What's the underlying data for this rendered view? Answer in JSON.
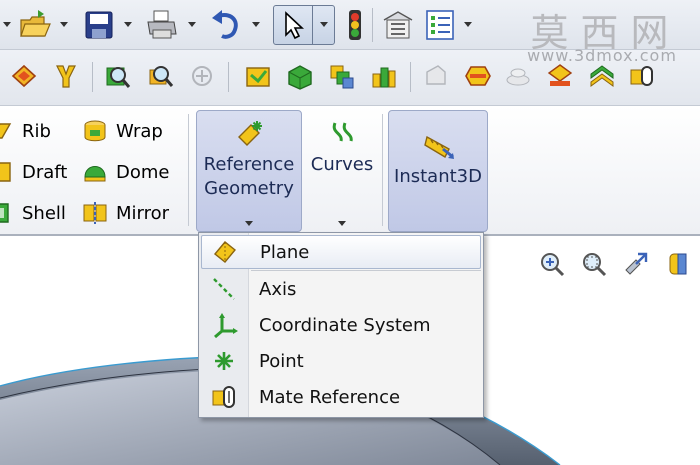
{
  "watermark": {
    "chinese": "莫西网",
    "url": "www.3dmox.com"
  },
  "toolbar_top": {
    "buttons": [
      {
        "id": "open",
        "icon": "open-folder-icon"
      },
      {
        "id": "save",
        "icon": "save-icon"
      },
      {
        "id": "print",
        "icon": "print-icon"
      },
      {
        "id": "undo",
        "icon": "undo-icon"
      },
      {
        "id": "select",
        "icon": "select-arrow-icon"
      },
      {
        "id": "rebuild",
        "icon": "traffic-light-icon"
      },
      {
        "id": "file-properties",
        "icon": "file-properties-icon"
      },
      {
        "id": "options",
        "icon": "options-list-icon"
      }
    ]
  },
  "features": {
    "col1": [
      {
        "label": "Rib",
        "icon": "rib-icon"
      },
      {
        "label": "Draft",
        "icon": "draft-icon"
      },
      {
        "label": "Shell",
        "icon": "shell-icon"
      }
    ],
    "col2": [
      {
        "label": "Wrap",
        "icon": "wrap-icon"
      },
      {
        "label": "Dome",
        "icon": "dome-icon"
      },
      {
        "label": "Mirror",
        "icon": "mirror-icon"
      }
    ]
  },
  "flyouts": {
    "reference_geometry": {
      "line1": "Reference",
      "line2": "Geometry"
    },
    "curves": {
      "label": "Curves"
    },
    "instant3d": {
      "label": "Instant3D"
    }
  },
  "menu": {
    "items": [
      {
        "label": "Plane",
        "icon": "plane-icon",
        "highlighted": true
      },
      {
        "label": "Axis",
        "icon": "axis-icon"
      },
      {
        "label": "Coordinate System",
        "icon": "coordinate-system-icon"
      },
      {
        "label": "Point",
        "icon": "point-icon"
      },
      {
        "label": "Mate Reference",
        "icon": "mate-reference-icon"
      }
    ]
  },
  "colors": {
    "accent_green": "#2e9a2e",
    "flyout_blue": "#c5cde9",
    "icon_yellow": "#f2c41a"
  }
}
